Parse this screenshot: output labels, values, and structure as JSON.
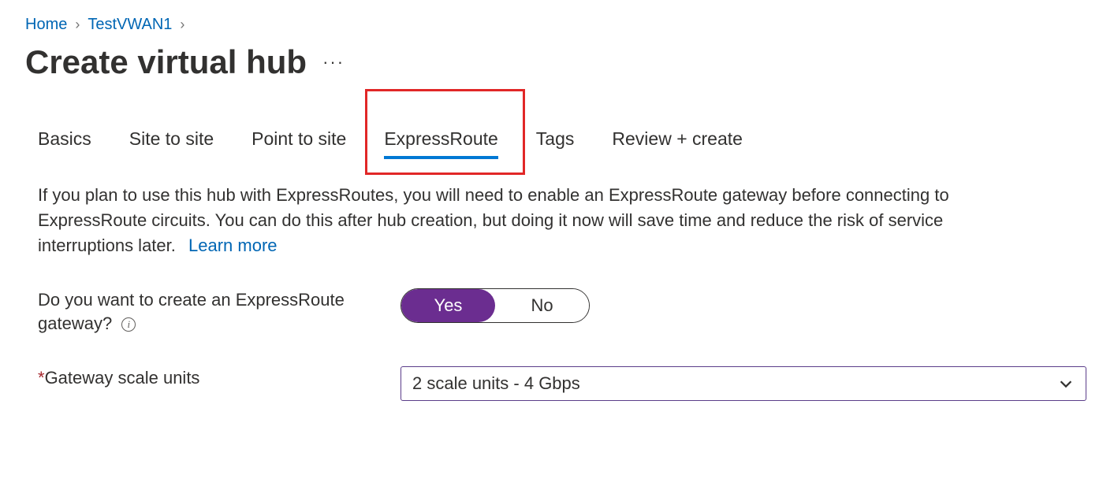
{
  "breadcrumb": {
    "home": "Home",
    "parent": "TestVWAN1"
  },
  "title": "Create virtual hub",
  "tabs": {
    "basics": "Basics",
    "site_to_site": "Site to site",
    "point_to_site": "Point to site",
    "expressroute": "ExpressRoute",
    "tags": "Tags",
    "review": "Review + create"
  },
  "description_text": "If you plan to use this hub with ExpressRoutes, you will need to enable an ExpressRoute gateway before connecting to ExpressRoute circuits. You can do this after hub creation, but doing it now will save time and reduce the risk of service interruptions later.",
  "learn_more": "Learn more",
  "form": {
    "gateway_question": "Do you want to create an ExpressRoute gateway?",
    "toggle_yes": "Yes",
    "toggle_no": "No",
    "scale_units_label": "Gateway scale units",
    "scale_units_value": "2 scale units - 4 Gbps"
  }
}
